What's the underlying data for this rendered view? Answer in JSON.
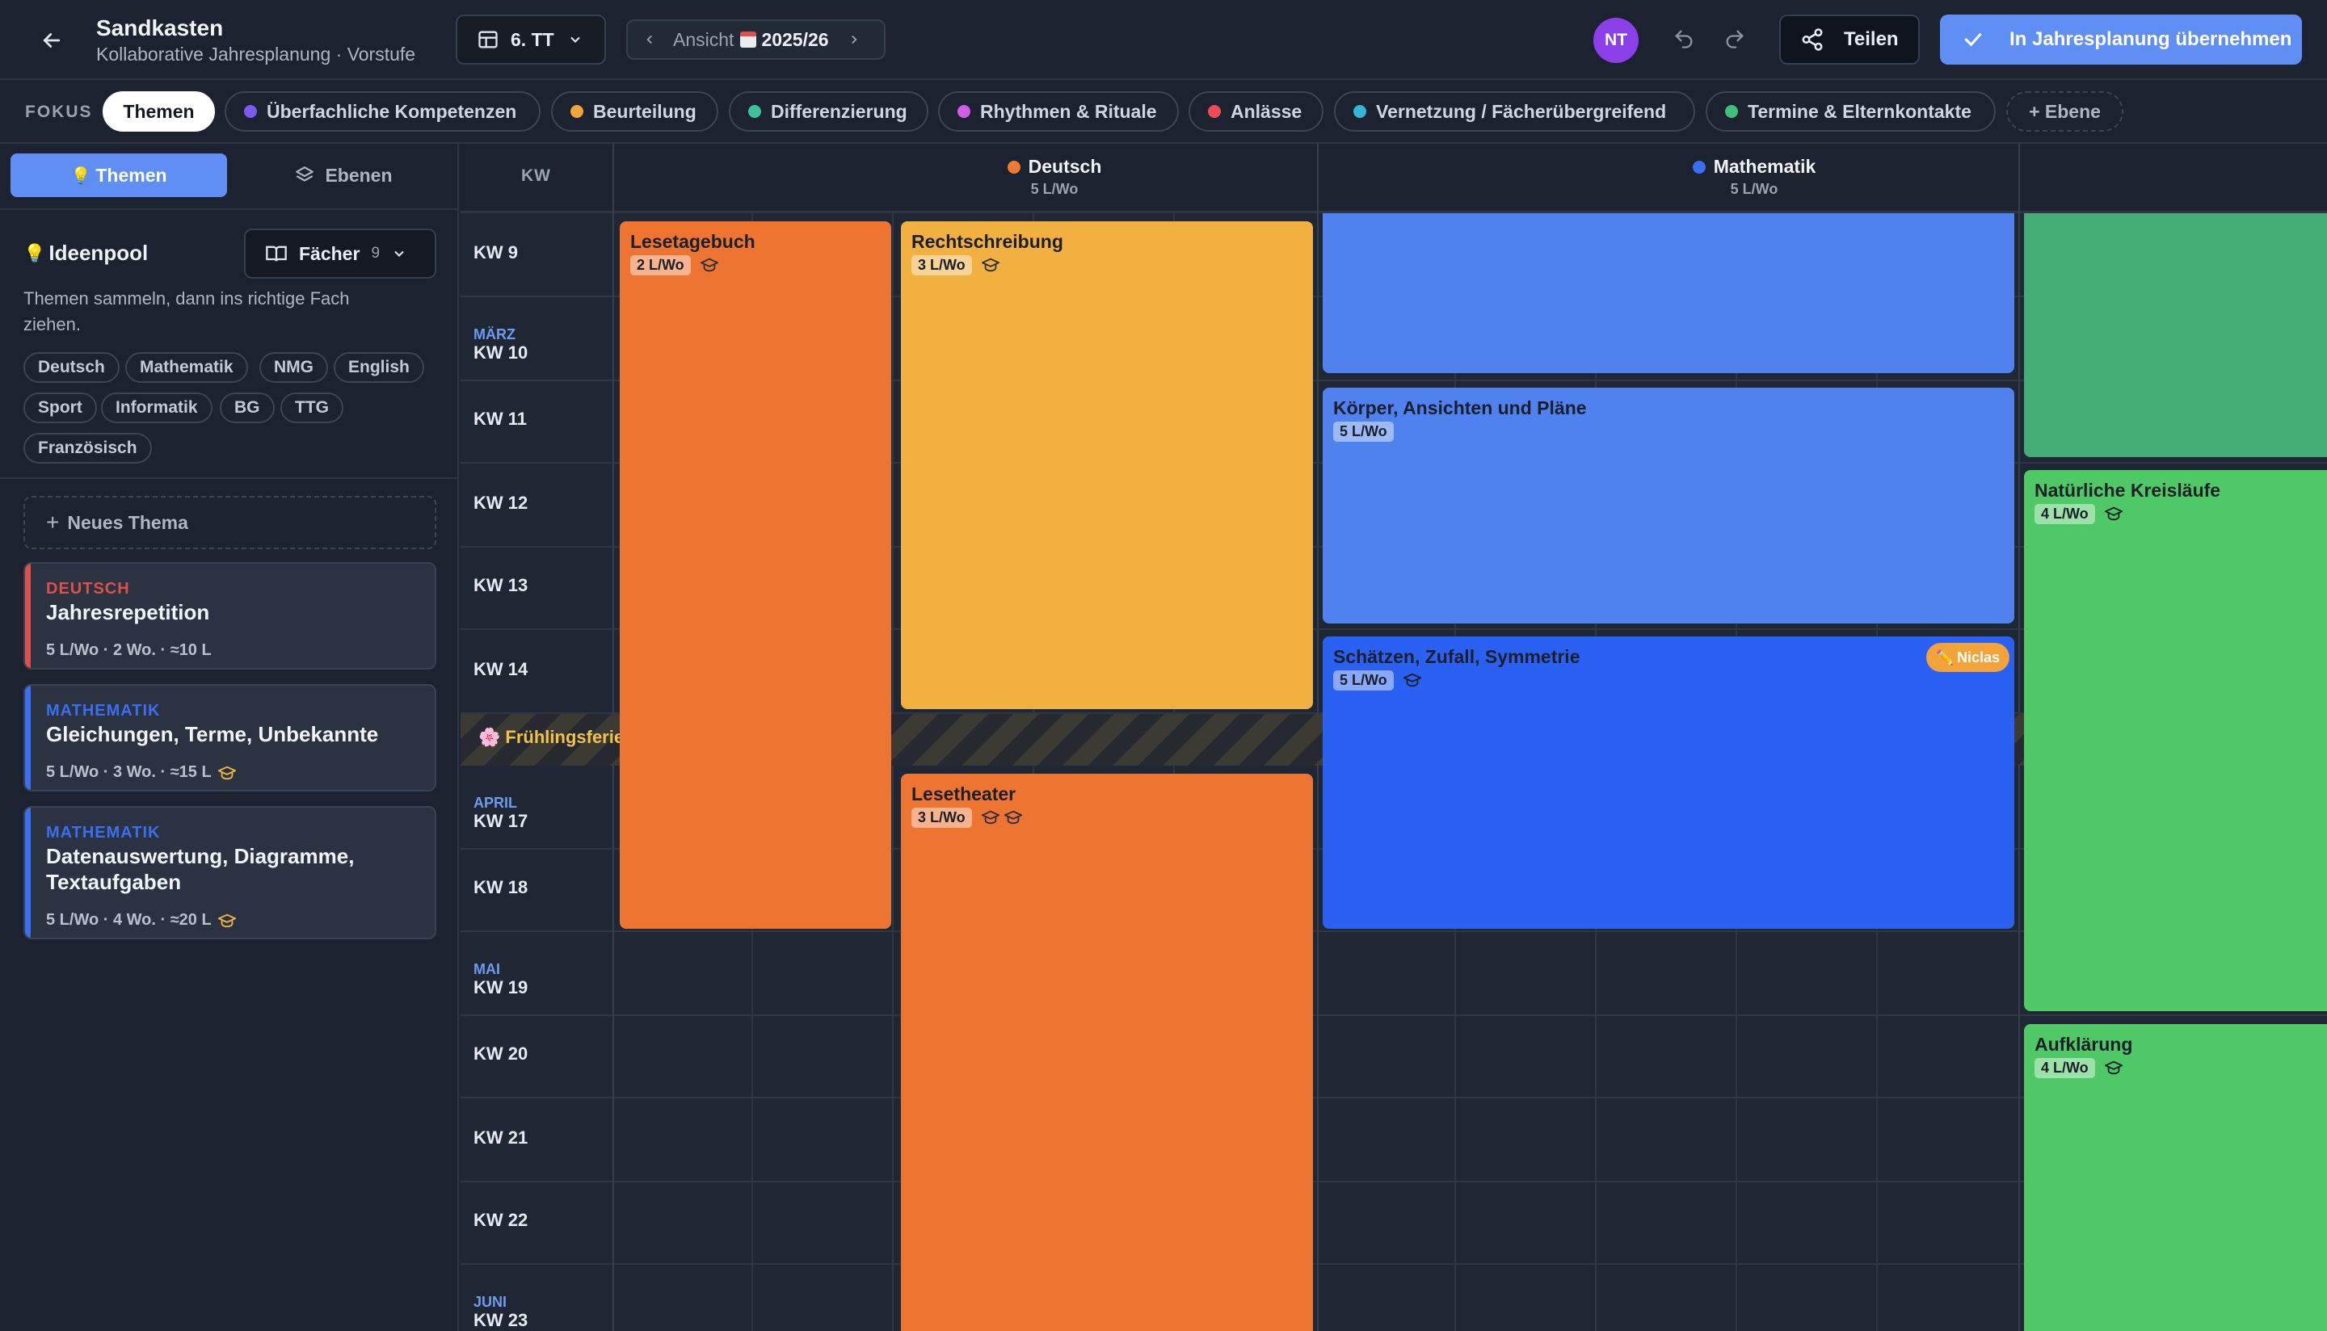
{
  "header": {
    "title": "Sandkasten",
    "subtitle": "Kollaborative Jahresplanung · Vorstufe",
    "class_select": "6. TT",
    "view_label": "Ansicht",
    "view_year": "2025/26",
    "avatar": "NT",
    "share_label": "Teilen",
    "adopt_label": "In Jahresplanung übernehmen"
  },
  "focus": {
    "label": "FOKUS",
    "items": [
      {
        "label": "Themen",
        "color": "#ffffff"
      },
      {
        "label": "Überfachliche Kompetenzen",
        "color": "#7a5af0"
      },
      {
        "label": "Beurteilung",
        "color": "#f2a43a"
      },
      {
        "label": "Differenzierung",
        "color": "#3fbf9a"
      },
      {
        "label": "Rhythmen & Rituale",
        "color": "#d45ae8"
      },
      {
        "label": "Anlässe",
        "color": "#ef4a56"
      },
      {
        "label": "Vernetzung / Fächerübergreifend",
        "color": "#35b6d9"
      },
      {
        "label": "Termine & Elternkontakte",
        "color": "#3fc07b"
      },
      {
        "label": "+ Ebene",
        "color": ""
      }
    ]
  },
  "sidebar": {
    "tab_themen": "Themen",
    "tab_ebenen": "Ebenen",
    "pool_title": "Ideenpool",
    "faecher_label": "Fächer",
    "faecher_count": "9",
    "hint": "Themen sammeln, dann ins richtige Fach ziehen.",
    "chips": [
      "Deutsch",
      "Mathematik",
      "NMG",
      "English",
      "Sport",
      "Informatik",
      "BG",
      "TTG",
      "Französisch"
    ],
    "new_theme": "Neues Thema",
    "cards": [
      {
        "subject": "DEUTSCH",
        "title": "Jahresrepetition",
        "meta": "5 L/Wo · 2 Wo. · ≈10 L",
        "color": "#e0504a"
      },
      {
        "subject": "MATHEMATIK",
        "title": "Gleichungen, Terme, Unbekannte",
        "meta": "5 L/Wo · 3 Wo. · ≈15 L",
        "color": "#3a6ff0"
      },
      {
        "subject": "MATHEMATIK",
        "title": "Datenauswertung, Diagramme, Textaufgaben",
        "meta": "5 L/Wo · 4 Wo. · ≈20 L",
        "color": "#3a6ff0"
      }
    ]
  },
  "calendar": {
    "kw_header": "KW",
    "subjects": [
      {
        "name": "Deutsch",
        "rate": "5 L/Wo",
        "color": "#f07a30"
      },
      {
        "name": "Mathematik",
        "rate": "5 L/Wo",
        "color": "#3a6ff0"
      }
    ],
    "rows": [
      {
        "month": "",
        "kw": "KW 9"
      },
      {
        "month": "MÄRZ",
        "kw": "KW 10"
      },
      {
        "month": "",
        "kw": "KW 11"
      },
      {
        "month": "",
        "kw": "KW 12"
      },
      {
        "month": "",
        "kw": "KW 13"
      },
      {
        "month": "",
        "kw": "KW 14"
      },
      {
        "month": "APRIL",
        "kw": "KW 17"
      },
      {
        "month": "",
        "kw": "KW 18"
      },
      {
        "month": "MAI",
        "kw": "KW 19"
      },
      {
        "month": "",
        "kw": "KW 20"
      },
      {
        "month": "",
        "kw": "KW 21"
      },
      {
        "month": "",
        "kw": "KW 22"
      },
      {
        "month": "JUNI",
        "kw": "KW 23"
      }
    ],
    "holiday": "Frühlingsferien",
    "events": {
      "lesetagebuch": {
        "title": "Lesetagebuch",
        "badge": "2 L/Wo"
      },
      "rechtschreibung": {
        "title": "Rechtschreibung",
        "badge": "3 L/Wo"
      },
      "lesetheater": {
        "title": "Lesetheater",
        "badge": "3 L/Wo"
      },
      "koerper": {
        "title": "Körper, Ansichten und Pläne",
        "badge": "5 L/Wo"
      },
      "schaetzen": {
        "title": "Schätzen, Zufall, Symmetrie",
        "badge": "5 L/Wo",
        "tag": "Niclas"
      },
      "kreislaeufe": {
        "title": "Natürliche Kreisläufe",
        "badge": "4 L/Wo"
      },
      "aufklaerung": {
        "title": "Aufklärung",
        "badge": "4 L/Wo"
      }
    }
  }
}
